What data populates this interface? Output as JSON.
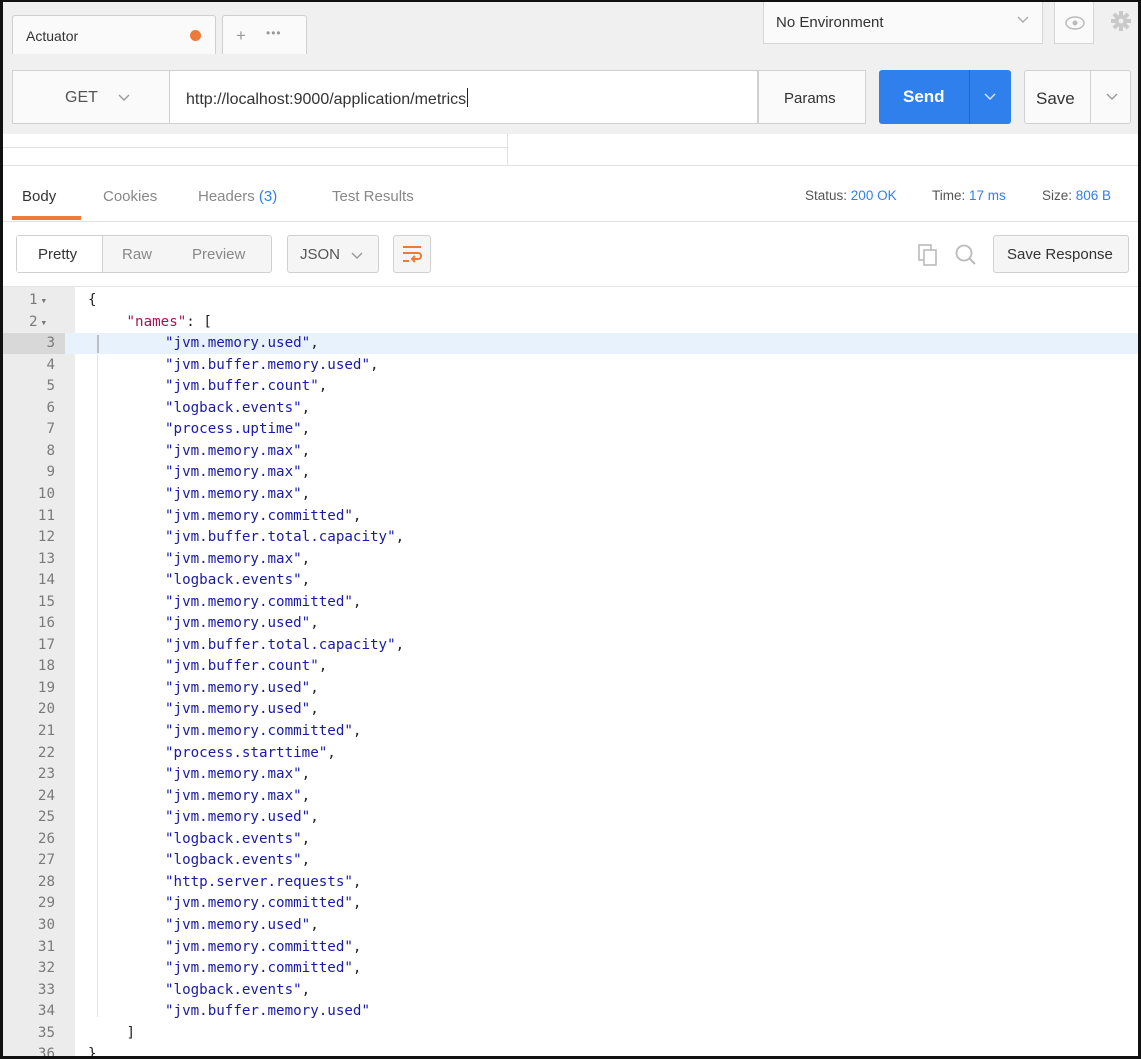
{
  "tabs": {
    "active_title": "Actuator",
    "add_label": "+",
    "more_label": "•••"
  },
  "environment": {
    "selected": "No Environment"
  },
  "request": {
    "method": "GET",
    "url": "http://localhost:9000/application/metrics",
    "params_label": "Params",
    "send_label": "Send",
    "save_label": "Save"
  },
  "response_tabs": {
    "body": "Body",
    "cookies": "Cookies",
    "headers": "Headers",
    "headers_count": "(3)",
    "test_results": "Test Results"
  },
  "status_bar": {
    "status_label": "Status:",
    "status_value": "200 OK",
    "time_label": "Time:",
    "time_value": "17 ms",
    "size_label": "Size:",
    "size_value": "806 B"
  },
  "body_toolbar": {
    "pretty": "Pretty",
    "raw": "Raw",
    "preview": "Preview",
    "format": "JSON",
    "save_response": "Save Response"
  },
  "editor": {
    "highlighted_line": 3,
    "lines": [
      {
        "num": "1",
        "fold": true,
        "indent": 0,
        "parts": [
          [
            "p",
            "{"
          ]
        ]
      },
      {
        "num": "2",
        "fold": true,
        "indent": 1,
        "parts": [
          [
            "k",
            "\"names\""
          ],
          [
            "p",
            ": ["
          ]
        ]
      },
      {
        "num": "3",
        "indent": 2,
        "parts": [
          [
            "s",
            "\"jvm.memory.used\""
          ],
          [
            "p",
            ","
          ]
        ]
      },
      {
        "num": "4",
        "indent": 2,
        "parts": [
          [
            "s",
            "\"jvm.buffer.memory.used\""
          ],
          [
            "p",
            ","
          ]
        ]
      },
      {
        "num": "5",
        "indent": 2,
        "parts": [
          [
            "s",
            "\"jvm.buffer.count\""
          ],
          [
            "p",
            ","
          ]
        ]
      },
      {
        "num": "6",
        "indent": 2,
        "parts": [
          [
            "s",
            "\"logback.events\""
          ],
          [
            "p",
            ","
          ]
        ]
      },
      {
        "num": "7",
        "indent": 2,
        "parts": [
          [
            "s",
            "\"process.uptime\""
          ],
          [
            "p",
            ","
          ]
        ]
      },
      {
        "num": "8",
        "indent": 2,
        "parts": [
          [
            "s",
            "\"jvm.memory.max\""
          ],
          [
            "p",
            ","
          ]
        ]
      },
      {
        "num": "9",
        "indent": 2,
        "parts": [
          [
            "s",
            "\"jvm.memory.max\""
          ],
          [
            "p",
            ","
          ]
        ]
      },
      {
        "num": "10",
        "indent": 2,
        "parts": [
          [
            "s",
            "\"jvm.memory.max\""
          ],
          [
            "p",
            ","
          ]
        ]
      },
      {
        "num": "11",
        "indent": 2,
        "parts": [
          [
            "s",
            "\"jvm.memory.committed\""
          ],
          [
            "p",
            ","
          ]
        ]
      },
      {
        "num": "12",
        "indent": 2,
        "parts": [
          [
            "s",
            "\"jvm.buffer.total.capacity\""
          ],
          [
            "p",
            ","
          ]
        ]
      },
      {
        "num": "13",
        "indent": 2,
        "parts": [
          [
            "s",
            "\"jvm.memory.max\""
          ],
          [
            "p",
            ","
          ]
        ]
      },
      {
        "num": "14",
        "indent": 2,
        "parts": [
          [
            "s",
            "\"logback.events\""
          ],
          [
            "p",
            ","
          ]
        ]
      },
      {
        "num": "15",
        "indent": 2,
        "parts": [
          [
            "s",
            "\"jvm.memory.committed\""
          ],
          [
            "p",
            ","
          ]
        ]
      },
      {
        "num": "16",
        "indent": 2,
        "parts": [
          [
            "s",
            "\"jvm.memory.used\""
          ],
          [
            "p",
            ","
          ]
        ]
      },
      {
        "num": "17",
        "indent": 2,
        "parts": [
          [
            "s",
            "\"jvm.buffer.total.capacity\""
          ],
          [
            "p",
            ","
          ]
        ]
      },
      {
        "num": "18",
        "indent": 2,
        "parts": [
          [
            "s",
            "\"jvm.buffer.count\""
          ],
          [
            "p",
            ","
          ]
        ]
      },
      {
        "num": "19",
        "indent": 2,
        "parts": [
          [
            "s",
            "\"jvm.memory.used\""
          ],
          [
            "p",
            ","
          ]
        ]
      },
      {
        "num": "20",
        "indent": 2,
        "parts": [
          [
            "s",
            "\"jvm.memory.used\""
          ],
          [
            "p",
            ","
          ]
        ]
      },
      {
        "num": "21",
        "indent": 2,
        "parts": [
          [
            "s",
            "\"jvm.memory.committed\""
          ],
          [
            "p",
            ","
          ]
        ]
      },
      {
        "num": "22",
        "indent": 2,
        "parts": [
          [
            "s",
            "\"process.starttime\""
          ],
          [
            "p",
            ","
          ]
        ]
      },
      {
        "num": "23",
        "indent": 2,
        "parts": [
          [
            "s",
            "\"jvm.memory.max\""
          ],
          [
            "p",
            ","
          ]
        ]
      },
      {
        "num": "24",
        "indent": 2,
        "parts": [
          [
            "s",
            "\"jvm.memory.max\""
          ],
          [
            "p",
            ","
          ]
        ]
      },
      {
        "num": "25",
        "indent": 2,
        "parts": [
          [
            "s",
            "\"jvm.memory.used\""
          ],
          [
            "p",
            ","
          ]
        ]
      },
      {
        "num": "26",
        "indent": 2,
        "parts": [
          [
            "s",
            "\"logback.events\""
          ],
          [
            "p",
            ","
          ]
        ]
      },
      {
        "num": "27",
        "indent": 2,
        "parts": [
          [
            "s",
            "\"logback.events\""
          ],
          [
            "p",
            ","
          ]
        ]
      },
      {
        "num": "28",
        "indent": 2,
        "parts": [
          [
            "s",
            "\"http.server.requests\""
          ],
          [
            "p",
            ","
          ]
        ]
      },
      {
        "num": "29",
        "indent": 2,
        "parts": [
          [
            "s",
            "\"jvm.memory.committed\""
          ],
          [
            "p",
            ","
          ]
        ]
      },
      {
        "num": "30",
        "indent": 2,
        "parts": [
          [
            "s",
            "\"jvm.memory.used\""
          ],
          [
            "p",
            ","
          ]
        ]
      },
      {
        "num": "31",
        "indent": 2,
        "parts": [
          [
            "s",
            "\"jvm.memory.committed\""
          ],
          [
            "p",
            ","
          ]
        ]
      },
      {
        "num": "32",
        "indent": 2,
        "parts": [
          [
            "s",
            "\"jvm.memory.committed\""
          ],
          [
            "p",
            ","
          ]
        ]
      },
      {
        "num": "33",
        "indent": 2,
        "parts": [
          [
            "s",
            "\"logback.events\""
          ],
          [
            "p",
            ","
          ]
        ]
      },
      {
        "num": "34",
        "indent": 2,
        "parts": [
          [
            "s",
            "\"jvm.buffer.memory.used\""
          ]
        ]
      },
      {
        "num": "35",
        "indent": 1,
        "parts": [
          [
            "p",
            "]"
          ]
        ]
      },
      {
        "num": "36",
        "indent": 0,
        "parts": [
          [
            "p",
            "}"
          ]
        ]
      }
    ]
  },
  "colors": {
    "send_blue": "#2f80ed",
    "active_tab_orange": "#ee7a3a",
    "json_key": "#a3155a",
    "json_string": "#1a1aa6"
  },
  "icons": [
    "chevron-down-icon",
    "eye-icon",
    "gear-icon",
    "wrap-lines-icon",
    "copy-icon",
    "search-icon",
    "fold-arrow-icon"
  ]
}
